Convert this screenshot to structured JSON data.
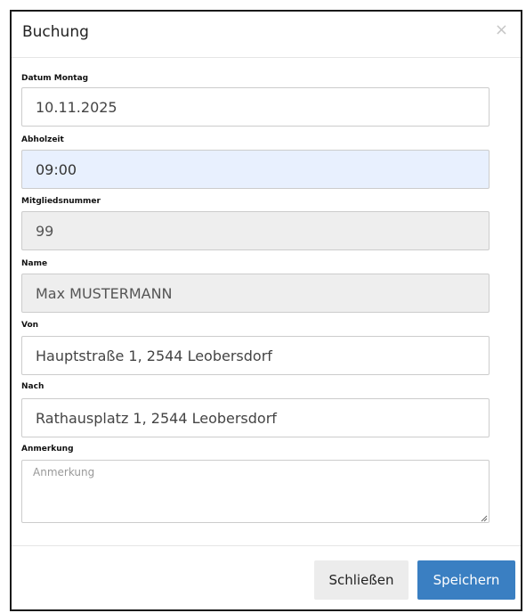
{
  "dialog": {
    "title": "Buchung",
    "close_symbol": "×"
  },
  "fields": {
    "datum": {
      "label": "Datum Montag",
      "value": "10.11.2025"
    },
    "abholzeit": {
      "label": "Abholzeit",
      "value": "09:00"
    },
    "mitgliedsnummer": {
      "label": "Mitgliedsnummer",
      "value": "99"
    },
    "name": {
      "label": "Name",
      "value": "Max MUSTERMANN"
    },
    "von": {
      "label": "Von",
      "value": "Hauptstraße 1, 2544 Leobersdorf"
    },
    "nach": {
      "label": "Nach",
      "value": "Rathausplatz 1, 2544 Leobersdorf"
    },
    "anmerkung": {
      "label": "Anmerkung",
      "placeholder": "Anmerkung",
      "value": ""
    }
  },
  "footer": {
    "close_label": "Schließen",
    "save_label": "Speichern"
  },
  "colors": {
    "primary": "#3a7fc2",
    "focused_field": "#e8f0fe",
    "readonly_field": "#eeeeee",
    "secondary_button": "#ececec"
  },
  "icons": {
    "close": "close-icon",
    "resize": "resize-handle-icon"
  }
}
